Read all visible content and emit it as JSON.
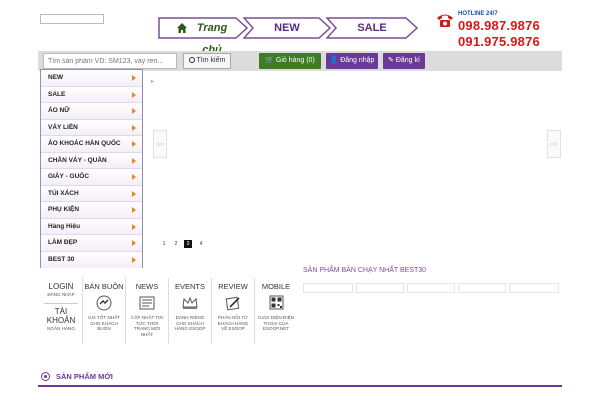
{
  "header": {
    "nav": [
      {
        "label": "Trang chủ"
      },
      {
        "label": "NEW"
      },
      {
        "label": "SALE"
      }
    ],
    "hotline_label": "HOTLINE 24/7",
    "phones": [
      "098.987.9876",
      "091.975.9876"
    ]
  },
  "toolbar": {
    "search_placeholder": "Tìm sản phẩm VD: SM123, váy ren...",
    "search_label": "Tìm kiếm",
    "cart_label": "Giỏ hàng (0)",
    "login_label": "Đăng nhập",
    "register_label": "Đăng kí"
  },
  "menu": {
    "items": [
      "NEW",
      "SALE",
      "ÁO NỮ",
      "VÁY LIỀN",
      "ÁO KHOÁC HÀN QUỐC",
      "CHÂN VÁY - QUẦN",
      "GIÀY - GUỐC",
      "TÚI XÁCH",
      "PHỤ KIỆN",
      "Hàng Hiệu",
      "LÀM ĐẸP",
      "BEST 30"
    ]
  },
  "slider": {
    "pages": [
      "1",
      "2",
      "3",
      "4"
    ],
    "active_page": "3"
  },
  "account": {
    "login_title": "LOGIN",
    "login_sub": "ĐĂNG NHẬP",
    "account_title": "TÀI KHOẢN",
    "account_sub": "NGÂN HÀNG"
  },
  "tabs": [
    {
      "title": "BÁN BUÔN",
      "desc": "GIÁ TỐT NHẤT CHO KHÁCH BUÔN",
      "icon": "wholesale-badge-icon"
    },
    {
      "title": "NEWS",
      "desc": "CẬP NHẬT TIN TỨC THỜI TRANG MỚI NHẤT",
      "icon": "news-icon"
    },
    {
      "title": "EVENTS",
      "desc": "DÀNH RIÊNG CHO KHÁCH HÀNG ESOOP",
      "icon": "crown-icon"
    },
    {
      "title": "REVIEW",
      "desc": "PHẢN HỒI TỪ KHÁCH HÀNG VỀ ESOOP",
      "icon": "pen-paper-icon"
    },
    {
      "title": "MOBILE",
      "desc": "GIAO DIỆN ĐIỆN THOẠI CỦA ESOOP.NET",
      "icon": "qr-code-icon"
    }
  ],
  "bestseller_title": "SẢN PHẨM BÁN CHẠY NHẤT BEST30",
  "new_products_title": "SẢN PHẨM MỚI",
  "colors": {
    "brand_purple": "#6b3a96",
    "home_green": "#2c5a14",
    "hotline_red": "#d41919",
    "menu_arrow": "#e08a1f"
  }
}
